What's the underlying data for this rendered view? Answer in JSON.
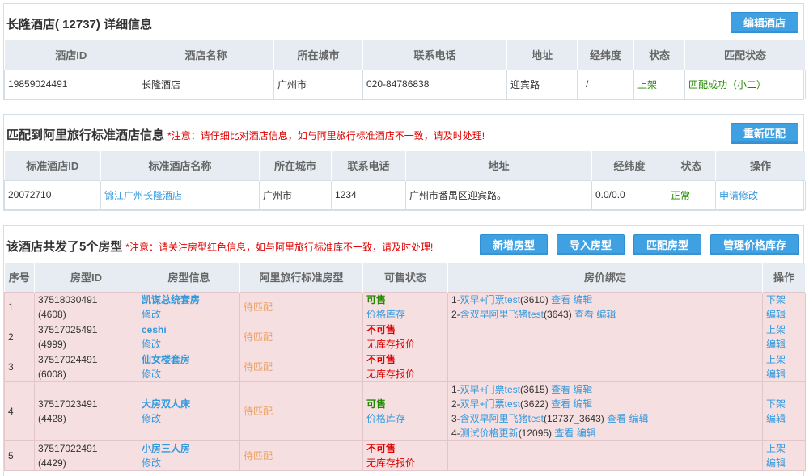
{
  "hotel": {
    "title": "长隆酒店( 12737) 详细信息",
    "edit_button": "编辑酒店",
    "columns": [
      "酒店ID",
      "酒店名称",
      "所在城市",
      "联系电话",
      "地址",
      "经纬度",
      "状态",
      "匹配状态"
    ],
    "row": {
      "id": "19859024491",
      "name": "长隆酒店",
      "city": "广州市",
      "phone": "020-84786838",
      "address": "迎宾路",
      "coords": "/",
      "status": "上架",
      "match_status": "匹配成功（小二）"
    }
  },
  "standard": {
    "title": "匹配到阿里旅行标准酒店信息",
    "note_star": "*",
    "note": "注意：请仔细比对酒店信息，如与阿里旅行标准酒店不一致，请及时处理!",
    "rematch_button": "重新匹配",
    "columns": [
      "标准酒店ID",
      "标准酒店名称",
      "所在城市",
      "联系电话",
      "地址",
      "经纬度",
      "状态",
      "操作"
    ],
    "row": {
      "id": "20072710",
      "name": "锦江广州长隆酒店",
      "city": "广州市",
      "phone": "1234",
      "address": "广州市番禺区迎宾路。",
      "coords": "0.0/0.0",
      "status": "正常",
      "action": "申请修改"
    }
  },
  "rooms": {
    "title": "该酒店共发了5个房型",
    "note_star": "*",
    "note": "注意：请关注房型红色信息，如与阿里旅行标准库不一致，请及时处理!",
    "buttons": {
      "add": "新增房型",
      "import": "导入房型",
      "match": "匹配房型",
      "price": "管理价格库存"
    },
    "columns": [
      "序号",
      "房型ID",
      "房型信息",
      "阿里旅行标准房型",
      "可售状态",
      "房价绑定",
      "操作"
    ],
    "rows": [
      {
        "no": "1",
        "id": "37518030491",
        "sub_id": "(4608)",
        "name": "凯谋总统套房",
        "edit": "修改",
        "std": "待匹配",
        "sale": "可售",
        "sale_sub": "价格库存",
        "bindings": [
          {
            "prefix": "1-",
            "name": "双早+门票test",
            "code": "(3610)",
            "view": "查看",
            "edit": "编辑"
          },
          {
            "prefix": "2-",
            "name": "含双早阿里飞猪test",
            "code": "(3643)",
            "view": "查看",
            "edit": "编辑"
          }
        ],
        "op1": "下架",
        "op2": "编辑"
      },
      {
        "no": "2",
        "id": "37517025491",
        "sub_id": "(4999)",
        "name": "ceshi",
        "edit": "修改",
        "std": "待匹配",
        "sale": "不可售",
        "sale_sub": "无库存报价",
        "bindings": [],
        "op1": "上架",
        "op2": "编辑"
      },
      {
        "no": "3",
        "id": "37517024491",
        "sub_id": "(6008)",
        "name": "仙女楼套房",
        "edit": "修改",
        "std": "待匹配",
        "sale": "不可售",
        "sale_sub": "无库存报价",
        "bindings": [],
        "op1": "上架",
        "op2": "编辑"
      },
      {
        "no": "4",
        "id": "37517023491",
        "sub_id": "(4428)",
        "name": "大房双人床",
        "edit": "修改",
        "std": "待匹配",
        "sale": "可售",
        "sale_sub": "价格库存",
        "bindings": [
          {
            "prefix": "1-",
            "name": "双早+门票test",
            "code": "(3615)",
            "view": "查看",
            "edit": "编辑"
          },
          {
            "prefix": "2-",
            "name": "双早+门票test",
            "code": "(3622)",
            "view": "查看",
            "edit": "编辑"
          },
          {
            "prefix": "3-",
            "name": "含双早阿里飞猪test",
            "code": "(12737_3643)",
            "view": "查看",
            "edit": "编辑"
          },
          {
            "prefix": "4-",
            "name": "测试价格更新",
            "code": "(12095)",
            "view": "查看",
            "edit": "编辑"
          }
        ],
        "op1": "下架",
        "op2": "编辑"
      },
      {
        "no": "5",
        "id": "37517022491",
        "sub_id": "(4429)",
        "name": "小房三人房",
        "edit": "修改",
        "std": "待匹配",
        "sale": "不可售",
        "sale_sub": "无库存报价",
        "bindings": [],
        "op1": "上架",
        "op2": "编辑"
      }
    ]
  }
}
